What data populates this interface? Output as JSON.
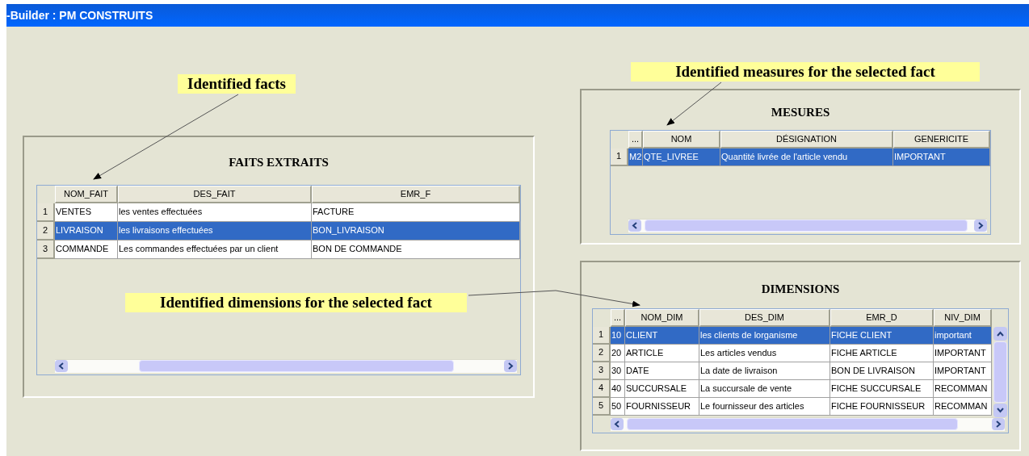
{
  "window": {
    "title": "-Builder : PM CONSTRUITS"
  },
  "callouts": [
    "Identified facts",
    "Identified measures for the selected fact",
    "Identified dimensions for the selected fact"
  ],
  "facts": {
    "title": "FAITS EXTRAITS",
    "columns": [
      "NOM_FAIT",
      "DES_FAIT",
      "EMR_F"
    ],
    "rows": [
      {
        "number": "1",
        "selected": false,
        "cells": [
          "VENTES",
          "les ventes effectuées",
          "FACTURE"
        ]
      },
      {
        "number": "2",
        "selected": true,
        "cells": [
          "LIVRAISON",
          "les livraisons effectuées",
          "BON_LIVRAISON"
        ]
      },
      {
        "number": "3",
        "selected": false,
        "cells": [
          "COMMANDE",
          "Les commandes effectuées par un client",
          "BON DE COMMANDE"
        ]
      }
    ]
  },
  "measures": {
    "title": "MESURES",
    "columns": [
      "...",
      "NOM",
      "DÉSIGNATION",
      "GENERICITE"
    ],
    "rows": [
      {
        "number": "1",
        "selected": true,
        "cells": [
          "M2",
          "QTE_LIVREE",
          "Quantité livrée de l'article vendu",
          "IMPORTANT"
        ]
      }
    ]
  },
  "dimensions": {
    "title": "DIMENSIONS",
    "columns": [
      "...",
      "NOM_DIM",
      "DES_DIM",
      "EMR_D",
      "NIV_DIM"
    ],
    "rows": [
      {
        "number": "1",
        "selected": true,
        "cells": [
          "10",
          "CLIENT",
          "les clients de lorganisme",
          "FICHE CLIENT",
          "important"
        ]
      },
      {
        "number": "2",
        "selected": false,
        "cells": [
          "20",
          "ARTICLE",
          "Les articles vendus",
          "FICHE ARTICLE",
          "IMPORTANT"
        ]
      },
      {
        "number": "3",
        "selected": false,
        "cells": [
          "30",
          "DATE",
          "La date de livraison",
          "BON DE LIVRAISON",
          "IMPORTANT"
        ]
      },
      {
        "number": "4",
        "selected": false,
        "cells": [
          "40",
          "SUCCURSALE",
          "La succursale de vente",
          "FICHE SUCCURSALE",
          "RECOMMAN"
        ]
      },
      {
        "number": "5",
        "selected": false,
        "cells": [
          "50",
          "FOURNISSEUR",
          "Le fournisseur des articles",
          "FICHE FOURNISSEUR",
          "RECOMMAN"
        ]
      }
    ]
  }
}
